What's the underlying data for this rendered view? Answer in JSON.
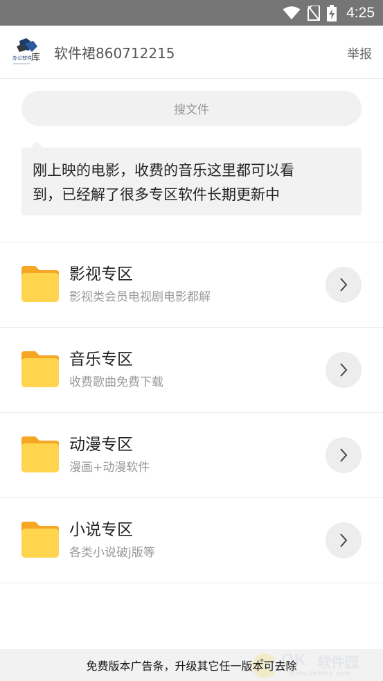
{
  "status_bar": {
    "time": "4:25",
    "icons": [
      "wifi-icon",
      "no-sim-icon",
      "battery-charging-icon"
    ]
  },
  "header": {
    "logo_text": "办公软件",
    "logo_char": "库",
    "group_name": "软件裙860712215",
    "report_label": "举报"
  },
  "search": {
    "placeholder": "搜文件"
  },
  "message": {
    "line1": "刚上映的电影，收费的音乐这里都可以看",
    "line2": "到，已经解了很多专区软件长期更新中"
  },
  "zones": [
    {
      "title": "影视专区",
      "desc": "影视类会员电视剧电影都解",
      "icon": "folder-icon"
    },
    {
      "title": "音乐专区",
      "desc": "收费歌曲免费下载",
      "icon": "folder-icon"
    },
    {
      "title": "动漫专区",
      "desc": "漫画+动漫软件",
      "icon": "folder-icon"
    },
    {
      "title": "小说专区",
      "desc": "各类小说破j版等",
      "icon": "folder-icon"
    }
  ],
  "ad": {
    "text": "免费版本广告条，升级其它任一版本可去除"
  },
  "watermark": {
    "brand": "OK",
    "name": "软件园",
    "url": "www.okemu.com"
  },
  "colors": {
    "status_bar": "#757575",
    "folder_front": "#FFD54F",
    "folder_back": "#F5A623",
    "arrow_bg": "#EDEDED"
  }
}
